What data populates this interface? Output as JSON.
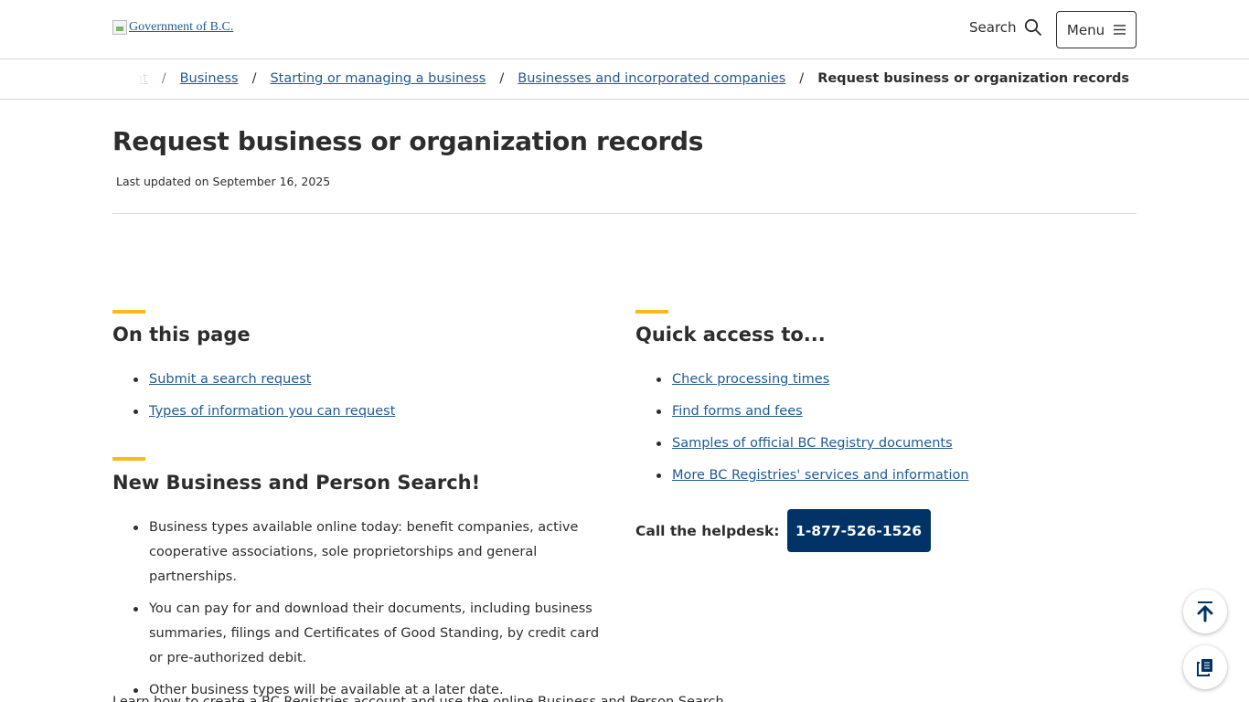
{
  "header": {
    "logo_alt": "Government of B.C.",
    "search_label": "Search",
    "menu_label": "Menu"
  },
  "breadcrumb": {
    "items": [
      {
        "label": "Economic development"
      },
      {
        "label": "Business"
      },
      {
        "label": "Starting or managing a business"
      },
      {
        "label": "Businesses and incorporated companies"
      }
    ],
    "current": "Request business or organization records",
    "separator": "/"
  },
  "page": {
    "title": "Request business or organization records",
    "last_updated": "Last updated on September 16, 2025"
  },
  "on_this_page": {
    "heading": "On this page",
    "links": [
      "Submit a search request",
      "Types of information you can request"
    ]
  },
  "new_search": {
    "heading": "New Business and Person Search!",
    "bullets": [
      "Business types available online today: benefit companies, active cooperative associations, sole proprietorships and general partnerships.",
      "You can pay for and download their documents, including business summaries, filings and Certificates of Good Standing, by credit card or pre-authorized debit.",
      "Other business types will be available at a later date."
    ],
    "cutoff_text": "Learn how to create a BC Registries account and use the online Business and Person Search"
  },
  "quick_access": {
    "heading": "Quick access to...",
    "links": [
      "Check processing times",
      "Find forms and fees",
      "Samples of official BC Registry documents",
      "More BC Registries' services and information"
    ]
  },
  "helpdesk": {
    "label": "Call the helpdesk:",
    "phone": "1-877-526-1526"
  },
  "colors": {
    "accent": "#fcba19",
    "link": "#255a90",
    "primary_button": "#013366",
    "text": "#2d2d2d"
  },
  "icons": {
    "search": "search-icon",
    "menu": "hamburger-icon",
    "back_to_top": "arrow-up-icon",
    "copy": "copy-icon"
  }
}
